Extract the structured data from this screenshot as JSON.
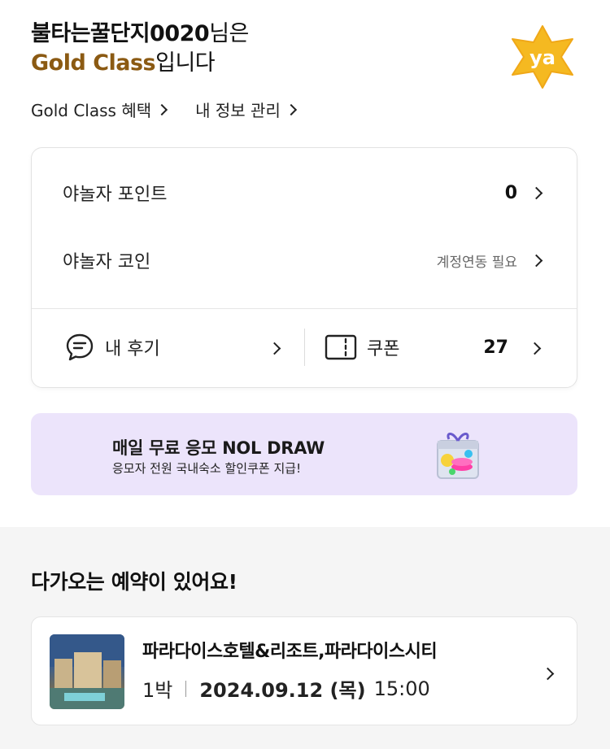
{
  "header": {
    "user_name": "불타는꿀단지0020",
    "name_suffix": "님은",
    "grade": "Gold Class",
    "grade_suffix": "입니다",
    "badge_text": "ya"
  },
  "links": {
    "benefits": "Gold Class 혜택",
    "my_info": "내 정보 관리"
  },
  "wallet": {
    "points_label": "야놀자 포인트",
    "points_value": "0",
    "coins_label": "야놀자 코인",
    "coins_value": "계정연동 필요",
    "reviews_label": "내 후기",
    "coupons_label": "쿠폰",
    "coupons_count": "27"
  },
  "banner": {
    "title": "매일 무료 응모 NOL DRAW",
    "description": "응모자 전원 국내숙소 할인쿠폰 지급!"
  },
  "reservation": {
    "section_title": "다가오는 예약이 있어요!",
    "hotel_name": "파라다이스호텔&리조트,파라다이스시티",
    "nights": "1박",
    "date": "2024.09.12 (목)",
    "time": "15:00"
  },
  "colors": {
    "grade": "#8b5a13",
    "badge": "#f5b921",
    "banner_bg": "#ece4fb",
    "section_bg": "#f5f5f5"
  }
}
